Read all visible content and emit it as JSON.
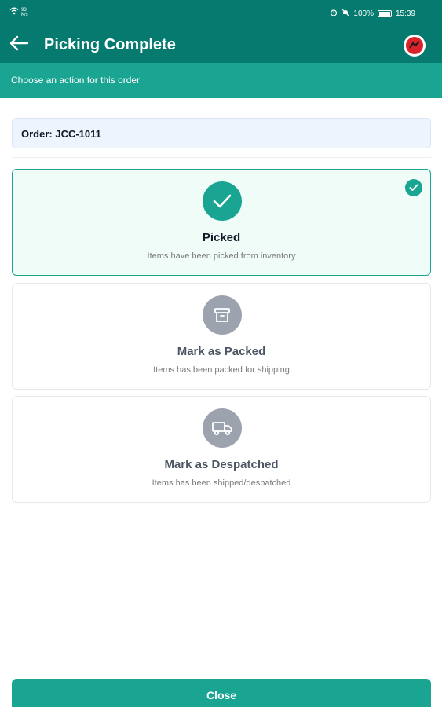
{
  "status_bar": {
    "network_top": "93",
    "network_bottom": "K/s",
    "battery": "100%",
    "time": "15:39"
  },
  "header": {
    "title": "Picking Complete",
    "subtitle": "Choose an action for this order"
  },
  "order": {
    "label": "Order: JCC-1011"
  },
  "actions": [
    {
      "title": "Picked",
      "description": "Items have been picked from inventory",
      "icon": "check-icon",
      "selected": true,
      "icon_color": "#1aa593"
    },
    {
      "title": "Mark as Packed",
      "description": "Items has been packed for shipping",
      "icon": "box-icon",
      "selected": false,
      "icon_color": "#9ca3af"
    },
    {
      "title": "Mark as Despatched",
      "description": "Items has been shipped/despatched",
      "icon": "truck-icon",
      "selected": false,
      "icon_color": "#9ca3af"
    }
  ],
  "footer": {
    "close_label": "Close"
  },
  "colors": {
    "primary_dark": "#067a6f",
    "primary": "#1aa593",
    "selected_bg": "#effcf8",
    "order_bg": "#eef4fd"
  }
}
